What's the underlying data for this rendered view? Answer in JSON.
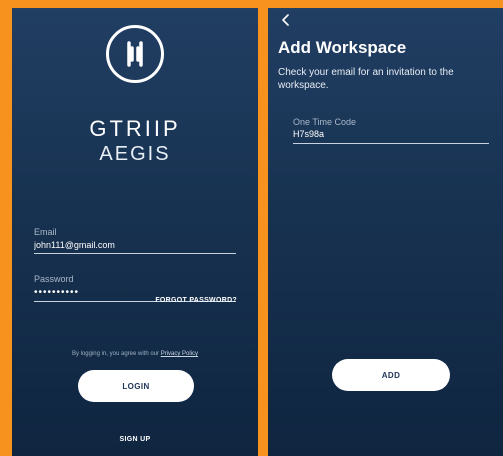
{
  "login": {
    "brand_line1": "GTRIIP",
    "brand_line2": "AEGIS",
    "email_label": "Email",
    "email_value": "john111@gmail.com",
    "password_label": "Password",
    "password_value": "••••••••••",
    "forgot_password": "FORGOT PASSWORD?",
    "legal_prefix": "By logging in, you agree with our ",
    "privacy_policy_link": "Privacy Policy",
    "login_button": "LOGIN",
    "signup_link": "SIGN UP"
  },
  "workspace": {
    "back_icon": "chevron-left-icon",
    "title": "Add Workspace",
    "subtitle": "Check your email for an invitation to the workspace.",
    "code_label": "One Time Code",
    "code_value": "H7s98a",
    "add_button": "ADD"
  },
  "colors": {
    "background": "#f7921e",
    "screen_top": "#213e63",
    "screen_bottom": "#0f2540",
    "button_bg": "#ffffff",
    "button_text": "#1e3557"
  }
}
